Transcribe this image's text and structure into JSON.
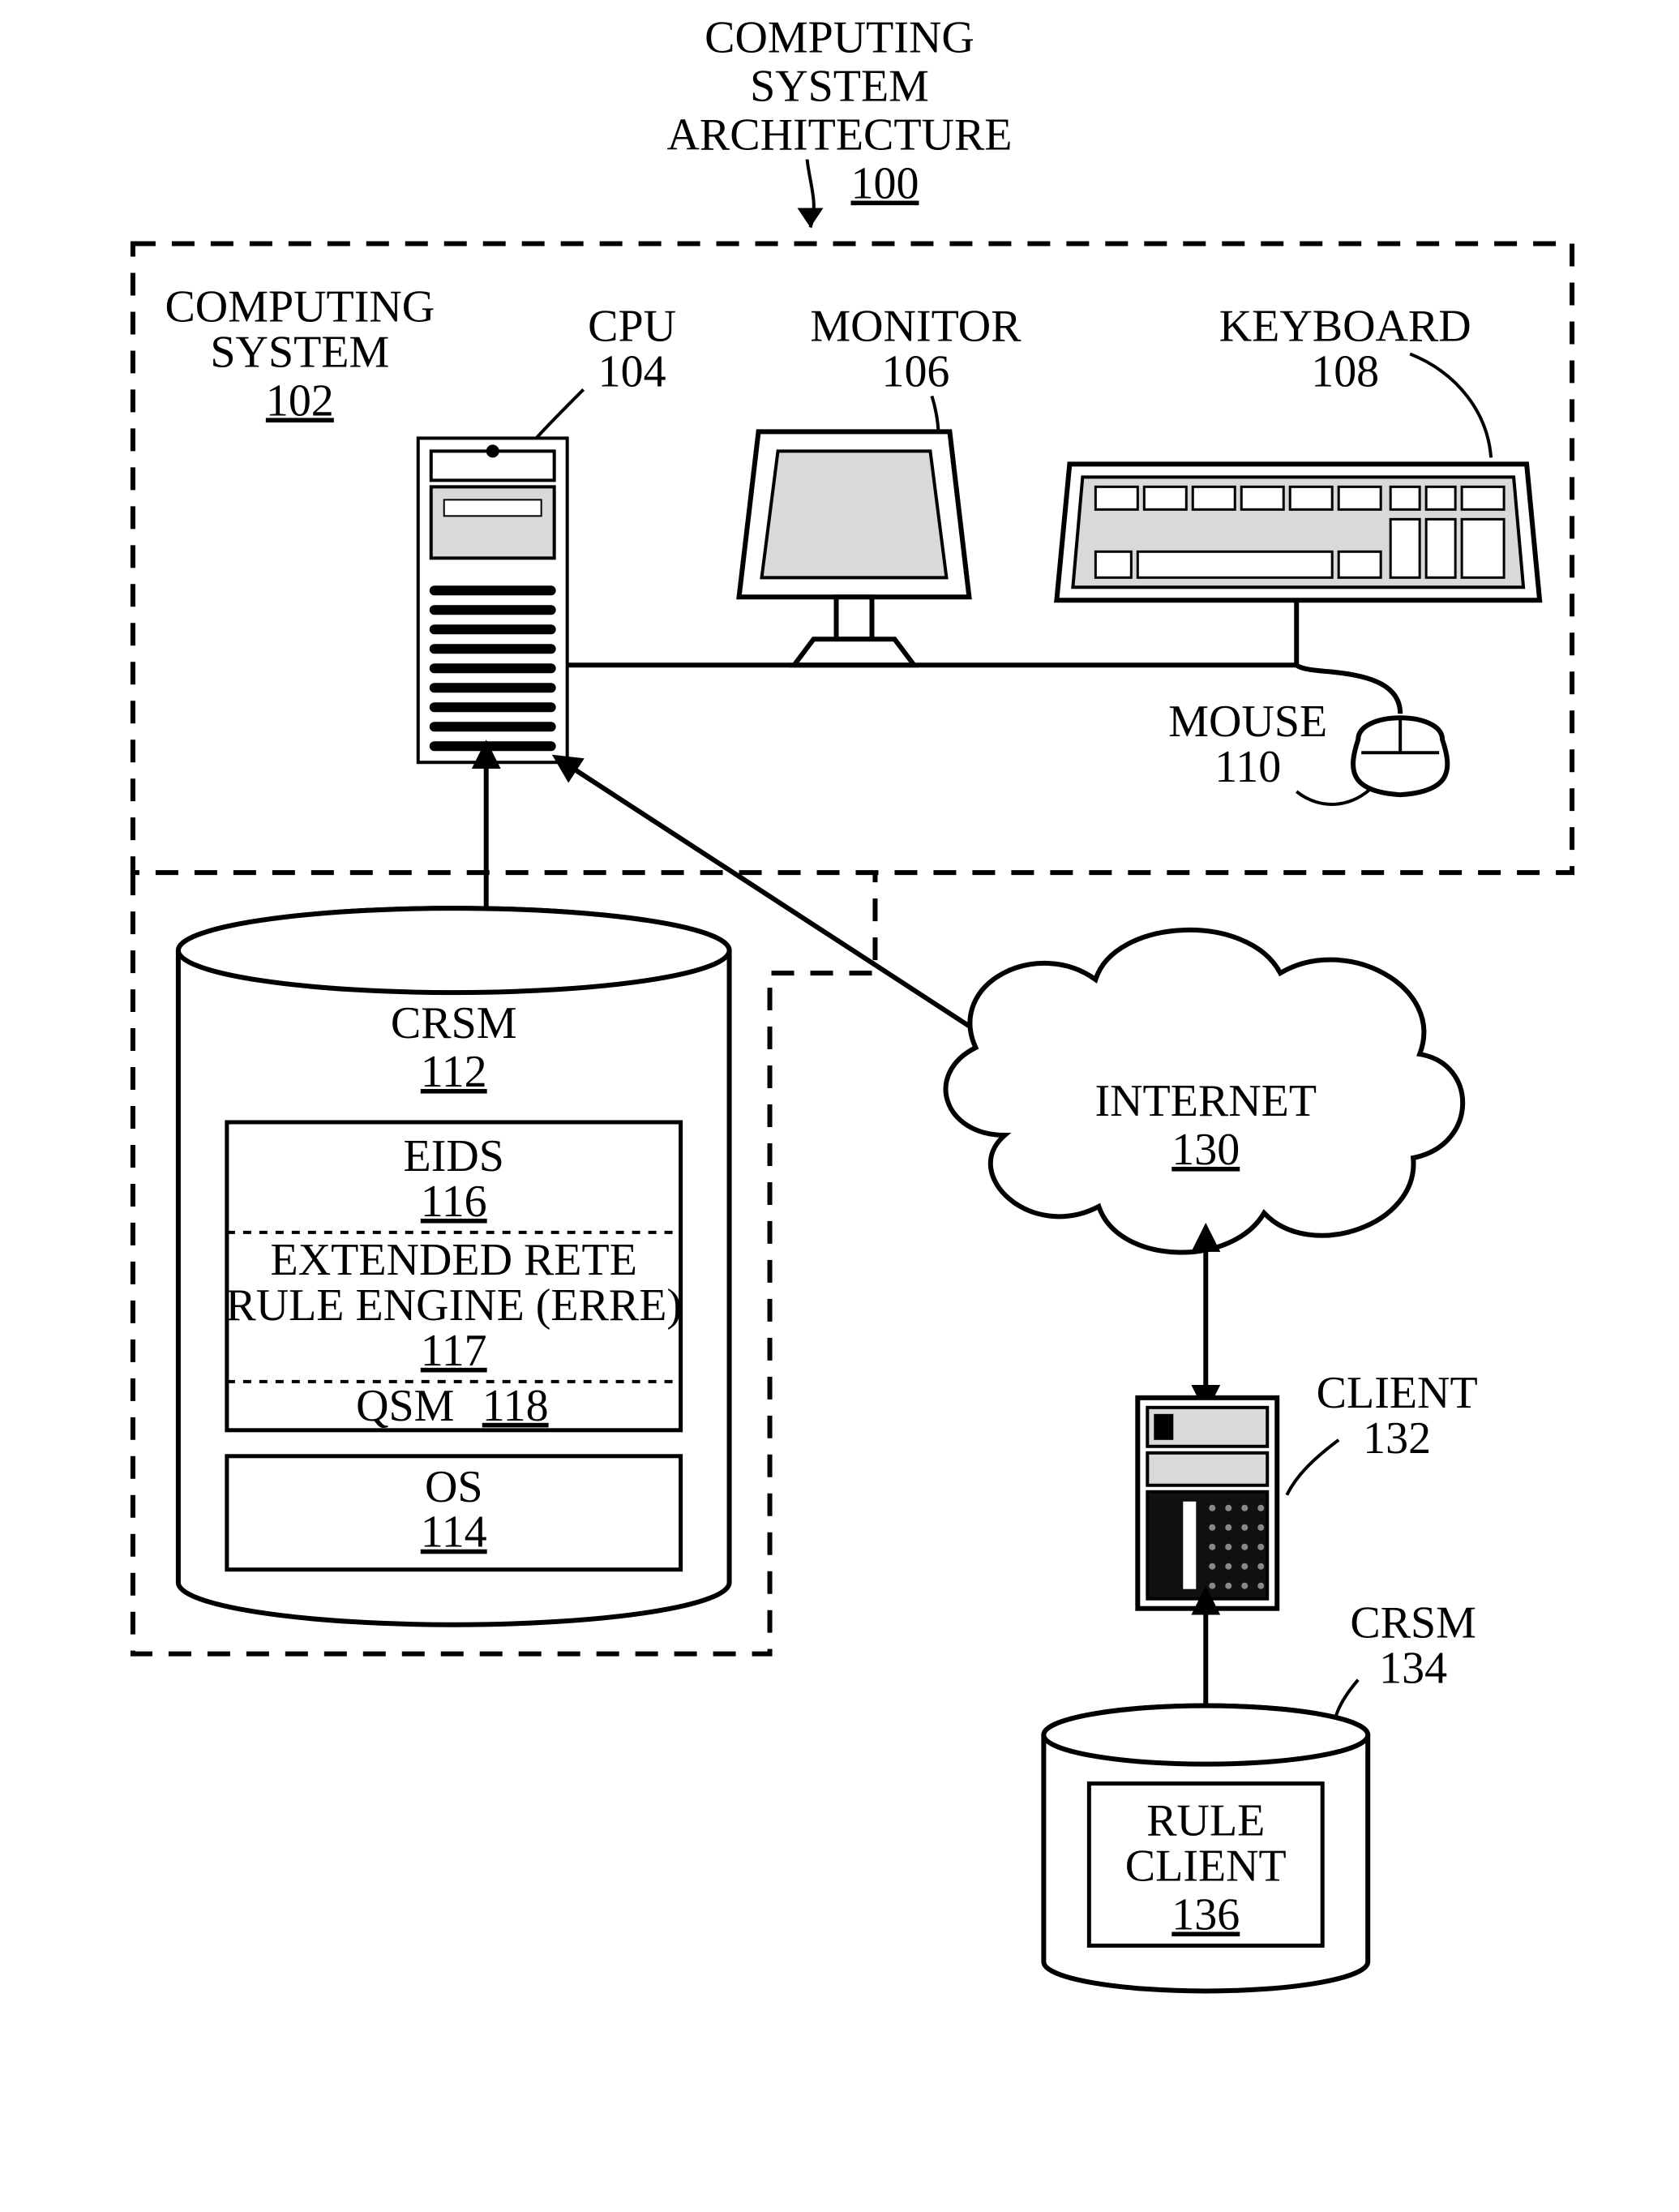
{
  "title": {
    "line1": "COMPUTING",
    "line2": "SYSTEM",
    "line3": "ARCHITECTURE",
    "ref": "100"
  },
  "computing_system": {
    "line1": "COMPUTING",
    "line2": "SYSTEM",
    "ref": "102"
  },
  "cpu": {
    "label": "CPU",
    "ref": "104"
  },
  "monitor": {
    "label": "MONITOR",
    "ref": "106"
  },
  "keyboard": {
    "label": "KEYBOARD",
    "ref": "108"
  },
  "mouse": {
    "label": "MOUSE",
    "ref": "110"
  },
  "crsm": {
    "label": "CRSM",
    "ref": "112"
  },
  "eids": {
    "label": "EIDS",
    "ref": "116"
  },
  "erre": {
    "line1": "EXTENDED RETE",
    "line2": "RULE ENGINE (ERRE)",
    "ref": "117"
  },
  "qsm": {
    "label": "QSM",
    "ref": "118"
  },
  "os": {
    "label": "OS",
    "ref": "114"
  },
  "internet": {
    "label": "INTERNET",
    "ref": "130"
  },
  "client": {
    "label": "CLIENT",
    "ref": "132"
  },
  "crsm2": {
    "label": "CRSM",
    "ref": "134"
  },
  "rule_client": {
    "line1": "RULE",
    "line2": "CLIENT",
    "ref": "136"
  }
}
